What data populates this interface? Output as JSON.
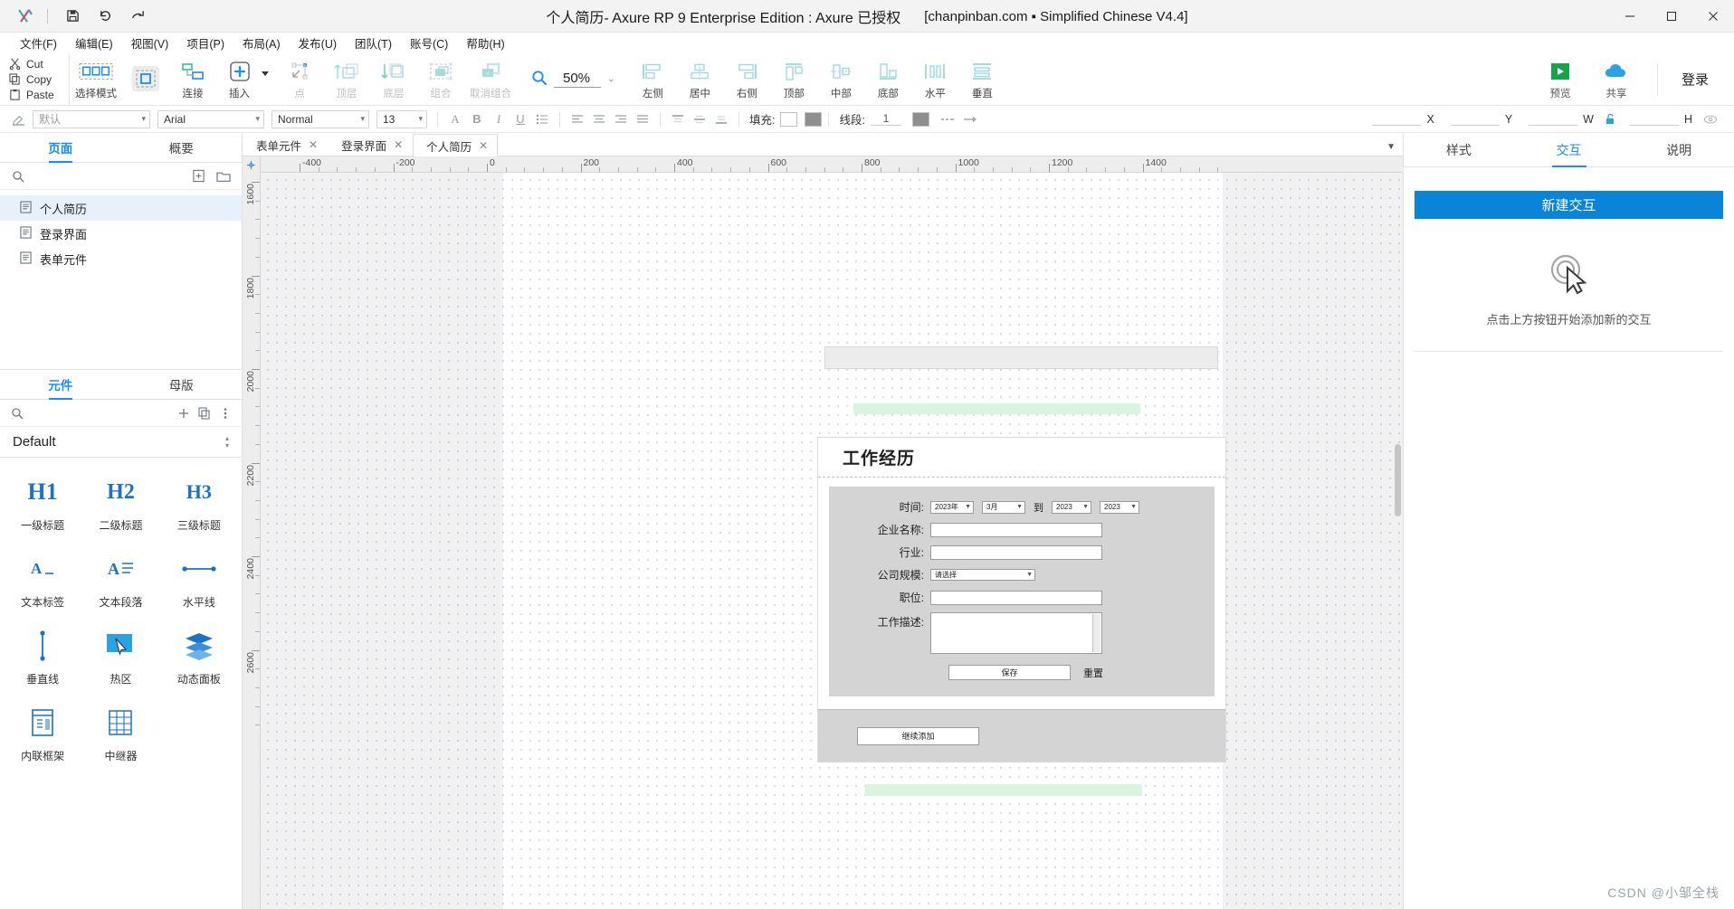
{
  "titlebar": {
    "doc_title": "个人简历",
    "app_title": " - Axure RP 9 Enterprise Edition : Axure 已授权",
    "bracket": "[chanpinban.com ▪ Simplified Chinese V4.4]",
    "logo": "axure-logo-icon",
    "save": "save-icon",
    "undo": "undo-icon",
    "redo": "redo-icon",
    "minimize": "−",
    "maximize": "▢",
    "close": "✕"
  },
  "menubar": {
    "items": [
      {
        "label": "文件(F)"
      },
      {
        "label": "编辑(E)"
      },
      {
        "label": "视图(V)"
      },
      {
        "label": "项目(P)"
      },
      {
        "label": "布局(A)"
      },
      {
        "label": "发布(U)"
      },
      {
        "label": "团队(T)"
      },
      {
        "label": "账号(C)"
      },
      {
        "label": "帮助(H)"
      }
    ]
  },
  "clipboard": {
    "cut": "Cut",
    "copy": "Copy",
    "paste": "Paste"
  },
  "toolbar": {
    "items": [
      {
        "label": "选择模式",
        "icon": "select-mode-icon",
        "disabled": false
      },
      {
        "label": "连接",
        "icon": "connect-icon",
        "disabled": false
      },
      {
        "label": "插入",
        "icon": "insert-icon",
        "disabled": false
      },
      {
        "label": "点",
        "icon": "point-icon",
        "disabled": true
      },
      {
        "label": "顶层",
        "icon": "bring-front-icon",
        "disabled": true
      },
      {
        "label": "底层",
        "icon": "send-back-icon",
        "disabled": true
      },
      {
        "label": "组合",
        "icon": "group-icon",
        "disabled": true
      },
      {
        "label": "取消组合",
        "icon": "ungroup-icon",
        "disabled": true
      }
    ],
    "zoom": {
      "icon": "magnifier-icon",
      "value": "50%"
    },
    "align": [
      {
        "label": "左侧",
        "icon": "align-left-icon"
      },
      {
        "label": "居中",
        "icon": "align-center-h-icon"
      },
      {
        "label": "右侧",
        "icon": "align-right-icon"
      },
      {
        "label": "顶部",
        "icon": "align-top-icon"
      },
      {
        "label": "中部",
        "icon": "align-middle-icon"
      },
      {
        "label": "底部",
        "icon": "align-bottom-icon"
      },
      {
        "label": "水平",
        "icon": "distribute-h-icon"
      },
      {
        "label": "垂直",
        "icon": "distribute-v-icon"
      }
    ],
    "preview": {
      "label": "预览",
      "icon": "play-icon"
    },
    "share": {
      "label": "共享",
      "icon": "cloud-icon"
    },
    "login": "登录"
  },
  "formatbar": {
    "style": "默认",
    "font": "Arial",
    "weight": "Normal",
    "size": "13",
    "text_tools": [
      "text-color-icon",
      "bold-icon",
      "italic-icon",
      "underline-icon",
      "list-icon"
    ],
    "align_tools": [
      "align-left-icon",
      "align-center-icon",
      "align-right-icon",
      "align-justify-icon",
      "valign-top-icon",
      "valign-middle-icon",
      "valign-bottom-icon"
    ],
    "fill_label": "填充:",
    "line_label": "线段:",
    "line_width": "1",
    "x_label": "X",
    "y_label": "Y",
    "w_label": "W",
    "h_label": "H",
    "lock_icon": "unlock-icon",
    "eye_icon": "eye-icon"
  },
  "leftpanel": {
    "tabs": [
      {
        "label": "页面",
        "selected": true
      },
      {
        "label": "概要",
        "selected": false
      }
    ],
    "search_placeholder": "",
    "search_icon": "search-icon",
    "add_page_icon": "add-page-icon",
    "add_folder_icon": "add-folder-icon",
    "pages": [
      {
        "label": "个人简历",
        "selected": true,
        "icon": "page-icon"
      },
      {
        "label": "登录界面",
        "selected": false,
        "icon": "page-icon"
      },
      {
        "label": "表单元件",
        "selected": false,
        "icon": "page-icon"
      }
    ],
    "library_tabs": [
      {
        "label": "元件",
        "selected": true
      },
      {
        "label": "母版",
        "selected": false
      }
    ],
    "library_search_icon": "search-icon",
    "library_add_icon": "add-icon",
    "library_copy_icon": "duplicate-icon",
    "library_more_icon": "more-vertical-icon",
    "library_selected": "Default",
    "widgets": [
      {
        "label": "一级标题",
        "glyph": "H1",
        "icon": "h1-icon"
      },
      {
        "label": "二级标题",
        "glyph": "H2",
        "icon": "h2-icon"
      },
      {
        "label": "三级标题",
        "glyph": "H3",
        "icon": "h3-icon"
      },
      {
        "label": "文本标签",
        "glyph": "",
        "icon": "text-label-icon"
      },
      {
        "label": "文本段落",
        "glyph": "",
        "icon": "paragraph-icon"
      },
      {
        "label": "水平线",
        "glyph": "",
        "icon": "horizontal-line-icon"
      },
      {
        "label": "垂直线",
        "glyph": "",
        "icon": "vertical-line-icon"
      },
      {
        "label": "热区",
        "glyph": "",
        "icon": "hotspot-icon"
      },
      {
        "label": "动态面板",
        "glyph": "",
        "icon": "dynamic-panel-icon"
      },
      {
        "label": "内联框架",
        "glyph": "",
        "icon": "inline-frame-icon"
      },
      {
        "label": "中继器",
        "glyph": "",
        "icon": "repeater-icon"
      }
    ]
  },
  "canvas": {
    "tabs": [
      {
        "label": "表单元件",
        "selected": false
      },
      {
        "label": "登录界面",
        "selected": false
      },
      {
        "label": "个人简历",
        "selected": true
      }
    ],
    "tab_close": "✕",
    "tab_overflow_icon": "chevron-down-icon",
    "ruler_h_labels": [
      "-400",
      "-200",
      "0",
      "200",
      "400",
      "600",
      "800",
      "1000",
      "1200",
      "1400"
    ],
    "ruler_v_labels": [
      "1600",
      "1800",
      "2000",
      "2200",
      "2400",
      "2600"
    ],
    "prototype": {
      "card_title": "工作经历",
      "fields": [
        {
          "label": "时间:",
          "type": "date-range"
        },
        {
          "label": "企业名称:",
          "type": "text"
        },
        {
          "label": "行业:",
          "type": "text"
        },
        {
          "label": "公司规模:",
          "type": "select"
        },
        {
          "label": "职位:",
          "type": "text"
        },
        {
          "label": "工作描述:",
          "type": "textarea"
        }
      ],
      "year_from": "2023年",
      "month_from": "3月",
      "to_label": "到",
      "year_to": "2023",
      "month_to": "2023",
      "company_size_placeholder": "请选择",
      "save_button": "保存",
      "reset_link": "重置",
      "add_more_button": "继续添加"
    }
  },
  "rightpanel": {
    "tabs": [
      {
        "label": "样式",
        "selected": false
      },
      {
        "label": "交互",
        "selected": true
      },
      {
        "label": "说明",
        "selected": false
      }
    ],
    "new_interaction_button": "新建交互",
    "empty_hint": "点击上方按钮开始添加新的交互",
    "empty_icon": "click-cursor-icon"
  },
  "watermark": {
    "text": "CSDN @小邹全栈"
  },
  "colors": {
    "accent": "#1a8cff",
    "primary_button": "#0a84d6",
    "titlebar_bg": "#f3f3f3",
    "canvas_dot": "#6b6be0",
    "green_band": "#d9f5df"
  }
}
